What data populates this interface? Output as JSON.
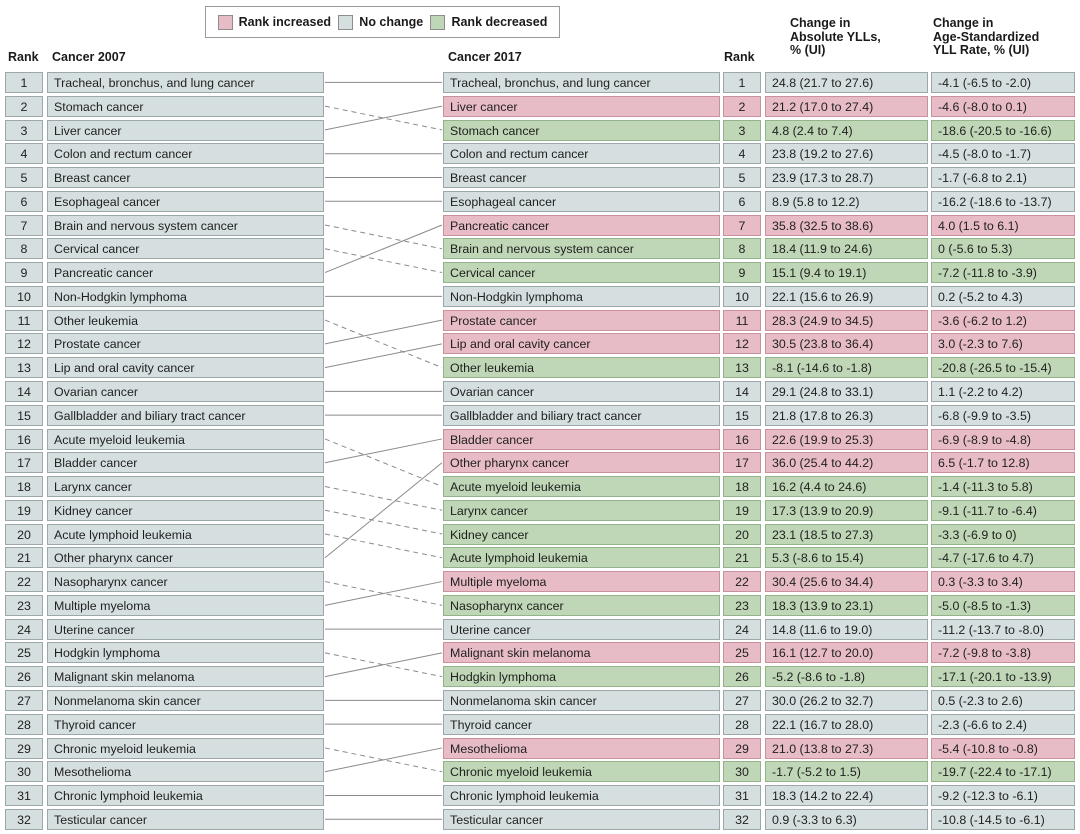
{
  "legend": {
    "items": [
      {
        "label": "Rank increased",
        "color": "#e8bcc6",
        "key": "up"
      },
      {
        "label": "No change",
        "color": "#d5dfe0",
        "key": "none"
      },
      {
        "label": "Rank decreased",
        "color": "#bfd7b6",
        "key": "down"
      }
    ]
  },
  "headers": {
    "rank_left": "Rank",
    "cancer_2007": "Cancer 2007",
    "cancer_2017": "Cancer 2017",
    "rank_right": "Rank",
    "change_absolute_ylls": "Change in\nAbsolute YLLs,\n% (UI)",
    "change_age_standardized": "Change in\nAge-Standardized\nYLL Rate, % (UI)"
  },
  "chart_data": {
    "type": "table",
    "title": "Change in cancer rank by years of life lost (YLLs), 2007 to 2017",
    "left_column_label": "Cancer 2007",
    "right_column_label": "Cancer 2017",
    "left_ranks": [
      {
        "rank": 1,
        "name": "Tracheal, bronchus, and lung cancer"
      },
      {
        "rank": 2,
        "name": "Stomach cancer"
      },
      {
        "rank": 3,
        "name": "Liver cancer"
      },
      {
        "rank": 4,
        "name": "Colon and rectum cancer"
      },
      {
        "rank": 5,
        "name": "Breast cancer"
      },
      {
        "rank": 6,
        "name": "Esophageal cancer"
      },
      {
        "rank": 7,
        "name": "Brain and nervous system cancer"
      },
      {
        "rank": 8,
        "name": "Cervical cancer"
      },
      {
        "rank": 9,
        "name": "Pancreatic cancer"
      },
      {
        "rank": 10,
        "name": "Non-Hodgkin lymphoma"
      },
      {
        "rank": 11,
        "name": "Other leukemia"
      },
      {
        "rank": 12,
        "name": "Prostate cancer"
      },
      {
        "rank": 13,
        "name": "Lip and oral cavity cancer"
      },
      {
        "rank": 14,
        "name": "Ovarian cancer"
      },
      {
        "rank": 15,
        "name": "Gallbladder and biliary tract cancer"
      },
      {
        "rank": 16,
        "name": "Acute myeloid leukemia"
      },
      {
        "rank": 17,
        "name": "Bladder cancer"
      },
      {
        "rank": 18,
        "name": "Larynx cancer"
      },
      {
        "rank": 19,
        "name": "Kidney cancer"
      },
      {
        "rank": 20,
        "name": "Acute lymphoid leukemia"
      },
      {
        "rank": 21,
        "name": "Other pharynx cancer"
      },
      {
        "rank": 22,
        "name": "Nasopharynx cancer"
      },
      {
        "rank": 23,
        "name": "Multiple myeloma"
      },
      {
        "rank": 24,
        "name": "Uterine cancer"
      },
      {
        "rank": 25,
        "name": "Hodgkin lymphoma"
      },
      {
        "rank": 26,
        "name": "Malignant skin melanoma"
      },
      {
        "rank": 27,
        "name": "Nonmelanoma skin cancer"
      },
      {
        "rank": 28,
        "name": "Thyroid cancer"
      },
      {
        "rank": 29,
        "name": "Chronic myeloid leukemia"
      },
      {
        "rank": 30,
        "name": "Mesothelioma"
      },
      {
        "rank": 31,
        "name": "Chronic lymphoid leukemia"
      },
      {
        "rank": 32,
        "name": "Testicular cancer"
      }
    ],
    "right_ranks": [
      {
        "rank": 1,
        "name": "Tracheal, bronchus, and lung cancer",
        "change": "none",
        "abs_yll": "24.8 (21.7 to 27.6)",
        "asr_yll": "-4.1 (-6.5 to -2.0)",
        "prev_rank": 1
      },
      {
        "rank": 2,
        "name": "Liver cancer",
        "change": "up",
        "abs_yll": "21.2 (17.0 to 27.4)",
        "asr_yll": "-4.6 (-8.0 to 0.1)",
        "prev_rank": 3
      },
      {
        "rank": 3,
        "name": "Stomach cancer",
        "change": "down",
        "abs_yll": "4.8 (2.4 to 7.4)",
        "asr_yll": "-18.6 (-20.5 to -16.6)",
        "prev_rank": 2
      },
      {
        "rank": 4,
        "name": "Colon and rectum cancer",
        "change": "none",
        "abs_yll": "23.8 (19.2 to 27.6)",
        "asr_yll": "-4.5 (-8.0 to -1.7)",
        "prev_rank": 4
      },
      {
        "rank": 5,
        "name": "Breast cancer",
        "change": "none",
        "abs_yll": "23.9 (17.3 to 28.7)",
        "asr_yll": "-1.7 (-6.8 to 2.1)",
        "prev_rank": 5
      },
      {
        "rank": 6,
        "name": "Esophageal cancer",
        "change": "none",
        "abs_yll": "8.9 (5.8 to 12.2)",
        "asr_yll": "-16.2 (-18.6 to -13.7)",
        "prev_rank": 6
      },
      {
        "rank": 7,
        "name": "Pancreatic cancer",
        "change": "up",
        "abs_yll": "35.8 (32.5 to 38.6)",
        "asr_yll": "4.0 (1.5 to 6.1)",
        "prev_rank": 9
      },
      {
        "rank": 8,
        "name": "Brain and nervous system cancer",
        "change": "down",
        "abs_yll": "18.4 (11.9 to 24.6)",
        "asr_yll": "0 (-5.6 to 5.3)",
        "prev_rank": 7
      },
      {
        "rank": 9,
        "name": "Cervical cancer",
        "change": "down",
        "abs_yll": "15.1 (9.4 to 19.1)",
        "asr_yll": "-7.2 (-11.8 to -3.9)",
        "prev_rank": 8
      },
      {
        "rank": 10,
        "name": "Non-Hodgkin lymphoma",
        "change": "none",
        "abs_yll": "22.1 (15.6 to 26.9)",
        "asr_yll": "0.2 (-5.2 to 4.3)",
        "prev_rank": 10
      },
      {
        "rank": 11,
        "name": "Prostate cancer",
        "change": "up",
        "abs_yll": "28.3 (24.9 to 34.5)",
        "asr_yll": "-3.6 (-6.2 to 1.2)",
        "prev_rank": 12
      },
      {
        "rank": 12,
        "name": "Lip and oral cavity cancer",
        "change": "up",
        "abs_yll": "30.5 (23.8 to 36.4)",
        "asr_yll": "3.0 (-2.3 to 7.6)",
        "prev_rank": 13
      },
      {
        "rank": 13,
        "name": "Other leukemia",
        "change": "down",
        "abs_yll": "-8.1 (-14.6 to -1.8)",
        "asr_yll": "-20.8 (-26.5 to -15.4)",
        "prev_rank": 11
      },
      {
        "rank": 14,
        "name": "Ovarian cancer",
        "change": "none",
        "abs_yll": "29.1 (24.8 to 33.1)",
        "asr_yll": "1.1 (-2.2 to 4.2)",
        "prev_rank": 14
      },
      {
        "rank": 15,
        "name": "Gallbladder and biliary tract cancer",
        "change": "none",
        "abs_yll": "21.8 (17.8 to 26.3)",
        "asr_yll": "-6.8 (-9.9 to -3.5)",
        "prev_rank": 15
      },
      {
        "rank": 16,
        "name": "Bladder cancer",
        "change": "up",
        "abs_yll": "22.6 (19.9 to 25.3)",
        "asr_yll": "-6.9 (-8.9 to -4.8)",
        "prev_rank": 17
      },
      {
        "rank": 17,
        "name": "Other pharynx cancer",
        "change": "up",
        "abs_yll": "36.0 (25.4 to 44.2)",
        "asr_yll": "6.5 (-1.7 to 12.8)",
        "prev_rank": 21
      },
      {
        "rank": 18,
        "name": "Acute myeloid leukemia",
        "change": "down",
        "abs_yll": "16.2 (4.4 to 24.6)",
        "asr_yll": "-1.4 (-11.3 to 5.8)",
        "prev_rank": 16
      },
      {
        "rank": 19,
        "name": "Larynx cancer",
        "change": "down",
        "abs_yll": "17.3 (13.9 to 20.9)",
        "asr_yll": "-9.1 (-11.7 to -6.4)",
        "prev_rank": 18
      },
      {
        "rank": 20,
        "name": "Kidney cancer",
        "change": "down",
        "abs_yll": "23.1 (18.5 to 27.3)",
        "asr_yll": "-3.3 (-6.9 to 0)",
        "prev_rank": 19
      },
      {
        "rank": 21,
        "name": "Acute lymphoid leukemia",
        "change": "down",
        "abs_yll": "5.3 (-8.6 to 15.4)",
        "asr_yll": "-4.7 (-17.6 to 4.7)",
        "prev_rank": 20
      },
      {
        "rank": 22,
        "name": "Multiple myeloma",
        "change": "up",
        "abs_yll": "30.4 (25.6 to 34.4)",
        "asr_yll": "0.3 (-3.3 to 3.4)",
        "prev_rank": 23
      },
      {
        "rank": 23,
        "name": "Nasopharynx cancer",
        "change": "down",
        "abs_yll": "18.3 (13.9 to 23.1)",
        "asr_yll": "-5.0 (-8.5 to -1.3)",
        "prev_rank": 22
      },
      {
        "rank": 24,
        "name": "Uterine cancer",
        "change": "none",
        "abs_yll": "14.8 (11.6 to 19.0)",
        "asr_yll": "-11.2 (-13.7 to -8.0)",
        "prev_rank": 24
      },
      {
        "rank": 25,
        "name": "Malignant skin melanoma",
        "change": "up",
        "abs_yll": "16.1 (12.7 to 20.0)",
        "asr_yll": "-7.2 (-9.8 to -3.8)",
        "prev_rank": 26
      },
      {
        "rank": 26,
        "name": "Hodgkin lymphoma",
        "change": "down",
        "abs_yll": "-5.2 (-8.6 to -1.8)",
        "asr_yll": "-17.1 (-20.1 to -13.9)",
        "prev_rank": 25
      },
      {
        "rank": 27,
        "name": "Nonmelanoma skin cancer",
        "change": "none",
        "abs_yll": "30.0 (26.2 to 32.7)",
        "asr_yll": "0.5 (-2.3 to 2.6)",
        "prev_rank": 27
      },
      {
        "rank": 28,
        "name": "Thyroid cancer",
        "change": "none",
        "abs_yll": "22.1 (16.7 to 28.0)",
        "asr_yll": "-2.3 (-6.6 to 2.4)",
        "prev_rank": 28
      },
      {
        "rank": 29,
        "name": "Mesothelioma",
        "change": "up",
        "abs_yll": "21.0 (13.8 to 27.3)",
        "asr_yll": "-5.4 (-10.8 to -0.8)",
        "prev_rank": 30
      },
      {
        "rank": 30,
        "name": "Chronic myeloid leukemia",
        "change": "down",
        "abs_yll": "-1.7 (-5.2 to 1.5)",
        "asr_yll": "-19.7 (-22.4 to -17.1)",
        "prev_rank": 29
      },
      {
        "rank": 31,
        "name": "Chronic lymphoid leukemia",
        "change": "none",
        "abs_yll": "18.3 (14.2 to 22.4)",
        "asr_yll": "-9.2 (-12.3 to -6.1)",
        "prev_rank": 31
      },
      {
        "rank": 32,
        "name": "Testicular cancer",
        "change": "none",
        "abs_yll": "0.9 (-3.3 to 6.3)",
        "asr_yll": "-10.8 (-14.5 to -6.1)",
        "prev_rank": 32
      }
    ]
  }
}
